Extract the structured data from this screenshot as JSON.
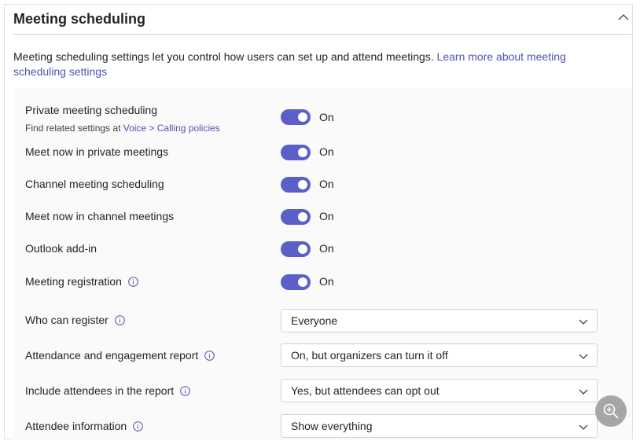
{
  "section": {
    "title": "Meeting scheduling",
    "collapse_icon": "chevron-up-icon"
  },
  "intro": {
    "text": "Meeting scheduling settings let you control how users can set up and attend meetings. ",
    "link": "Learn more about meeting scheduling settings"
  },
  "settings": {
    "private_scheduling": {
      "label": "Private meeting scheduling",
      "sub_prefix": "Find related settings at ",
      "sub_link": "Voice > Calling policies",
      "state": "On"
    },
    "meet_now_private": {
      "label": "Meet now in private meetings",
      "state": "On"
    },
    "channel_scheduling": {
      "label": "Channel meeting scheduling",
      "state": "On"
    },
    "meet_now_channel": {
      "label": "Meet now in channel meetings",
      "state": "On"
    },
    "outlook_addin": {
      "label": "Outlook add-in",
      "state": "On"
    },
    "registration": {
      "label": "Meeting registration",
      "state": "On"
    },
    "who_can_register": {
      "label": "Who can register",
      "value": "Everyone"
    },
    "attendance_report": {
      "label": "Attendance and engagement report",
      "value": "On, but organizers can turn it off"
    },
    "include_attendees": {
      "label": "Include attendees in the report",
      "value": "Yes, but attendees can opt out"
    },
    "attendee_info": {
      "label": "Attendee information",
      "value": "Show everything"
    }
  },
  "colors": {
    "toggle_on": "#5b5fc7",
    "link": "#4f52b2"
  }
}
